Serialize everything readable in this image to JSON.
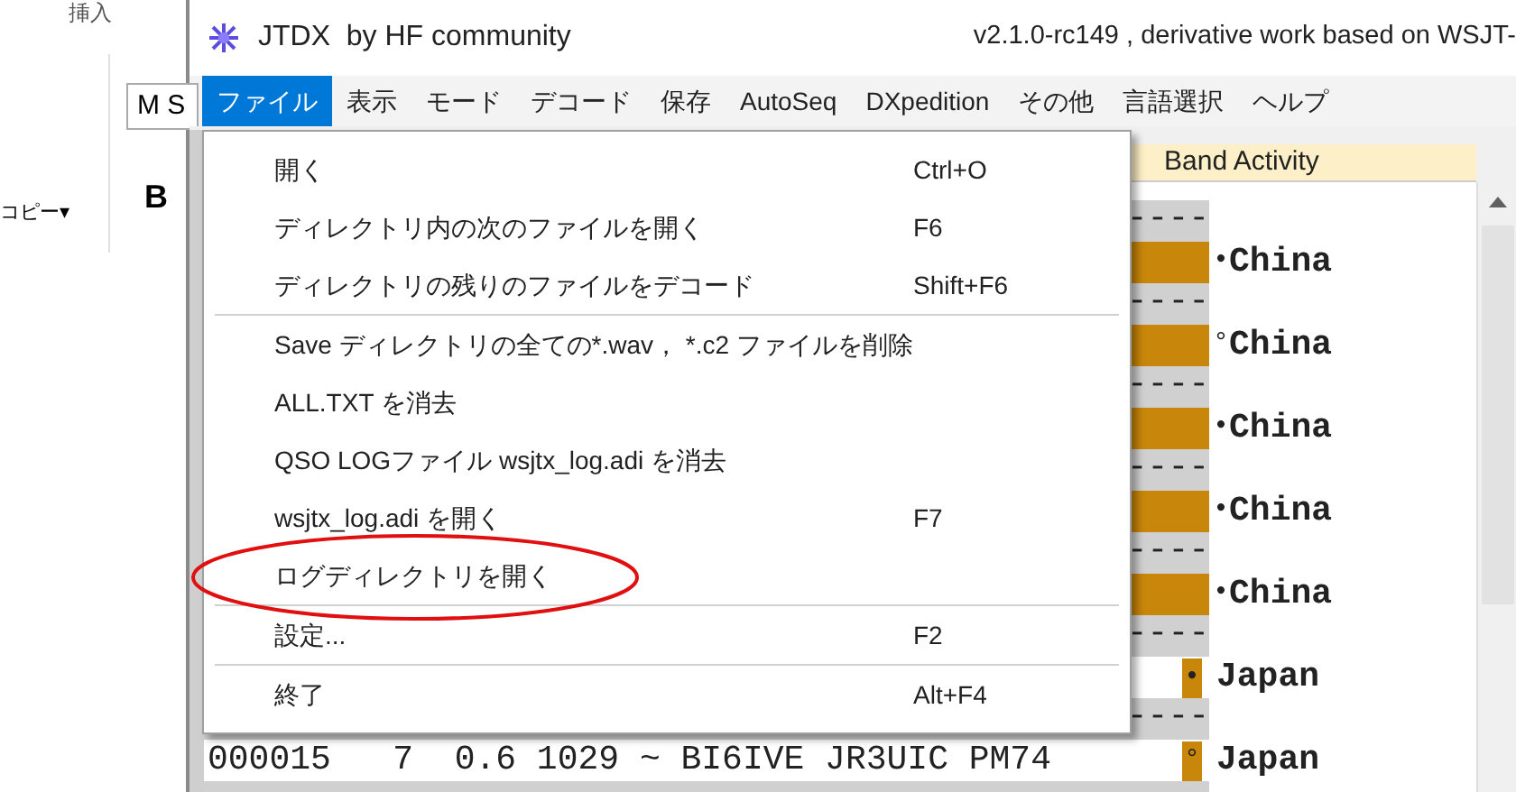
{
  "background_app": {
    "tab": "挿入",
    "font_field": "M S",
    "bold_button": "B",
    "copy_button": "コピー▾"
  },
  "window": {
    "title": "JTDX  by HF community",
    "version": "v2.1.0-rc149 , derivative work based on WSJT-"
  },
  "menu_bar": [
    {
      "label": "ファイル",
      "selected": true
    },
    {
      "label": "表示",
      "selected": false
    },
    {
      "label": "モード",
      "selected": false
    },
    {
      "label": "デコード",
      "selected": false
    },
    {
      "label": "保存",
      "selected": false
    },
    {
      "label": "AutoSeq",
      "selected": false
    },
    {
      "label": "DXpedition",
      "selected": false
    },
    {
      "label": "その他",
      "selected": false
    },
    {
      "label": "言語選択",
      "selected": false
    },
    {
      "label": "ヘルプ",
      "selected": false
    }
  ],
  "file_menu": [
    {
      "kind": "item",
      "label": "開く",
      "shortcut": "Ctrl+O",
      "circled": false
    },
    {
      "kind": "item",
      "label": "ディレクトリ内の次のファイルを開く",
      "shortcut": "F6",
      "circled": false
    },
    {
      "kind": "item",
      "label": "ディレクトリの残りのファイルをデコード",
      "shortcut": "Shift+F6",
      "circled": false
    },
    {
      "kind": "separator"
    },
    {
      "kind": "item",
      "label": "Save ディレクトリの全ての*.wav， *.c2 ファイルを削除",
      "circled": false
    },
    {
      "kind": "item",
      "label": "ALL.TXT を消去",
      "circled": false
    },
    {
      "kind": "item",
      "label": "QSO LOGファイル wsjtx_log.adi を消去",
      "circled": false
    },
    {
      "kind": "item",
      "label": "wsjtx_log.adi を開く",
      "shortcut": "F7",
      "circled": false
    },
    {
      "kind": "item",
      "label": "ログディレクトリを開く",
      "circled": true
    },
    {
      "kind": "separator"
    },
    {
      "kind": "item",
      "label": "設定...",
      "shortcut": "F2",
      "circled": false
    },
    {
      "kind": "separator"
    },
    {
      "kind": "item",
      "label": "終了",
      "shortcut": "Alt+F4",
      "circled": false
    }
  ],
  "band_activity": {
    "title": "Band Activity",
    "rows": [
      {
        "kind": "separator",
        "text": "----"
      },
      {
        "kind": "decode",
        "symbol": "•",
        "country": "China"
      },
      {
        "kind": "separator",
        "text": "----"
      },
      {
        "kind": "decode",
        "symbol": "°",
        "country": "China"
      },
      {
        "kind": "separator",
        "text": "----"
      },
      {
        "kind": "decode",
        "symbol": "•",
        "country": "China"
      },
      {
        "kind": "separator",
        "text": "----"
      },
      {
        "kind": "decode",
        "symbol": "•",
        "country": "China"
      },
      {
        "kind": "separator",
        "text": "----"
      },
      {
        "kind": "decode",
        "symbol": "•",
        "country": "China"
      },
      {
        "kind": "separator",
        "text": "----"
      },
      {
        "kind": "marked",
        "symbol": "•",
        "country": "Japan"
      },
      {
        "kind": "separator",
        "text": "----"
      },
      {
        "kind": "marked",
        "message": "000015   7  0.6 1029 ~ BI6IVE JR3UIC PM74",
        "symbol": "°",
        "country": "Japan"
      }
    ]
  }
}
